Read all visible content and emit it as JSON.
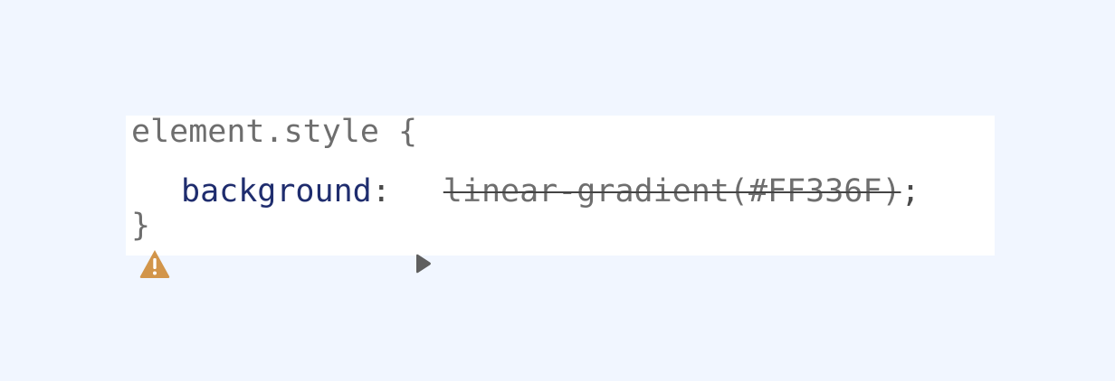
{
  "rule": {
    "selector": "element.style",
    "open_brace": "{",
    "close_brace": "}",
    "declaration": {
      "warning_icon": "warning-triangle-icon",
      "property": "background",
      "colon": ":",
      "expand_icon": "triangle-right-icon",
      "value": "linear-gradient(#FF336F)",
      "semicolon": ";",
      "overridden": true
    }
  },
  "colors": {
    "page_background": "#f1f6ff",
    "panel_background": "#ffffff",
    "property_name": "#1f2d6e",
    "value_text": "#6e6e6e",
    "warning": "#d2954a"
  }
}
